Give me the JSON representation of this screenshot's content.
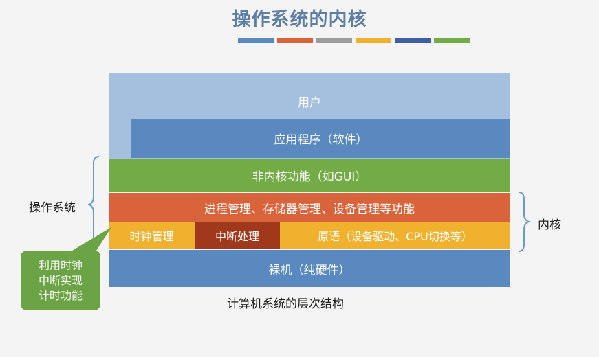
{
  "title": "操作系统的内核",
  "stripe_colors": [
    "#5a89c0",
    "#d9633b",
    "#9c9c9c",
    "#f0b12e",
    "#3f5fa3",
    "#73ac47"
  ],
  "layers": {
    "user": "用户",
    "app": "应用程序（软件）",
    "non_kernel": "非内核功能（如GUI）",
    "process_mgmt": "进程管理、存储器管理、设备管理等功能",
    "clock_mgmt": "时钟管理",
    "interrupt": "中断处理",
    "primitives": "原语（设备驱动、CPU切换等）",
    "bare_machine": "裸机（纯硬件）"
  },
  "labels": {
    "os": "操作系统",
    "kernel": "内核"
  },
  "callout": [
    "利用时钟",
    "中断实现",
    "计时功能"
  ],
  "caption": "计算机系统的层次结构"
}
